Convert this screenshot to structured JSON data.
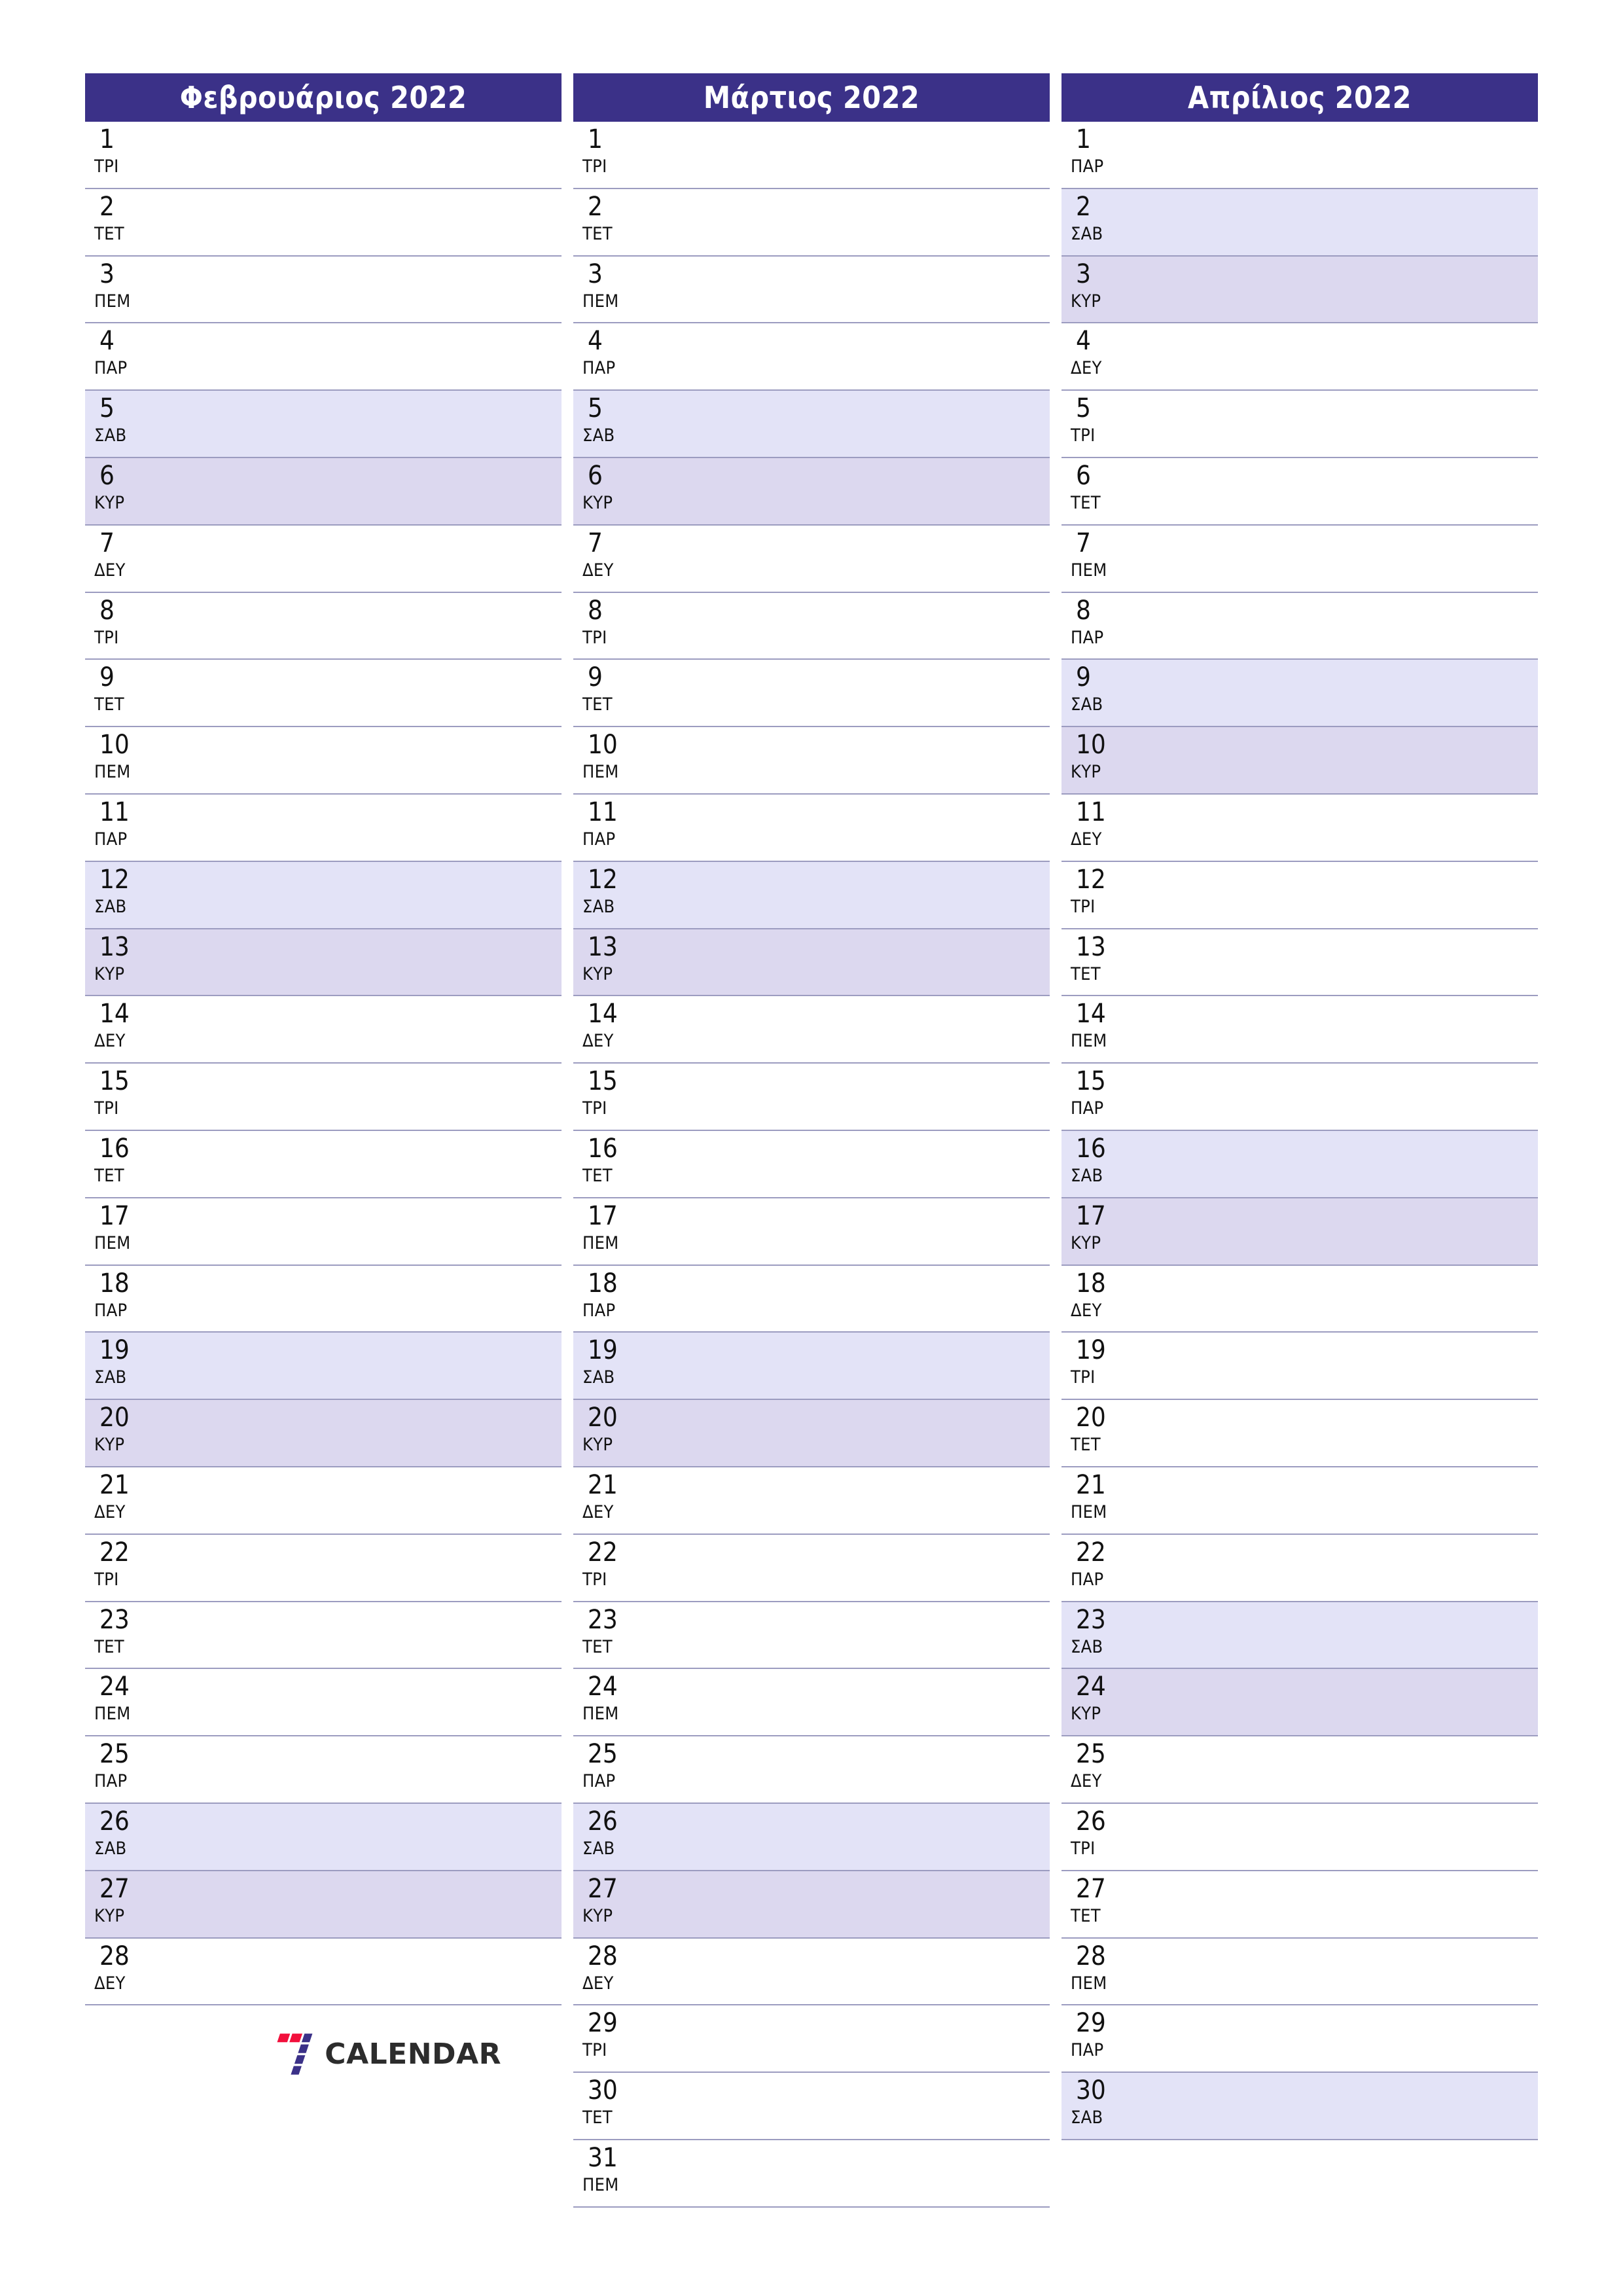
{
  "colors": {
    "header_bg": "#3b3188",
    "header_text": "#ffffff",
    "saturday_bg": "#e3e3f7",
    "sunday_bg": "#dcd8ef",
    "row_divider": "#9c9cc0",
    "day_text": "#111111",
    "logo_red": "#f2103c",
    "logo_blue": "#3b3188",
    "logo_word": "#2c2c2c"
  },
  "logo": {
    "mark": "seven-logo-icon",
    "word": "CALENDAR"
  },
  "months": [
    {
      "title": "Φεβρουάριος 2022",
      "days": [
        {
          "num": "1",
          "abbr": "ΤΡΙ",
          "type": "weekday"
        },
        {
          "num": "2",
          "abbr": "ΤΕΤ",
          "type": "weekday"
        },
        {
          "num": "3",
          "abbr": "ΠΕΜ",
          "type": "weekday"
        },
        {
          "num": "4",
          "abbr": "ΠΑΡ",
          "type": "weekday"
        },
        {
          "num": "5",
          "abbr": "ΣΑΒ",
          "type": "sat"
        },
        {
          "num": "6",
          "abbr": "ΚΥΡ",
          "type": "sun"
        },
        {
          "num": "7",
          "abbr": "ΔΕΥ",
          "type": "weekday"
        },
        {
          "num": "8",
          "abbr": "ΤΡΙ",
          "type": "weekday"
        },
        {
          "num": "9",
          "abbr": "ΤΕΤ",
          "type": "weekday"
        },
        {
          "num": "10",
          "abbr": "ΠΕΜ",
          "type": "weekday"
        },
        {
          "num": "11",
          "abbr": "ΠΑΡ",
          "type": "weekday"
        },
        {
          "num": "12",
          "abbr": "ΣΑΒ",
          "type": "sat"
        },
        {
          "num": "13",
          "abbr": "ΚΥΡ",
          "type": "sun"
        },
        {
          "num": "14",
          "abbr": "ΔΕΥ",
          "type": "weekday"
        },
        {
          "num": "15",
          "abbr": "ΤΡΙ",
          "type": "weekday"
        },
        {
          "num": "16",
          "abbr": "ΤΕΤ",
          "type": "weekday"
        },
        {
          "num": "17",
          "abbr": "ΠΕΜ",
          "type": "weekday"
        },
        {
          "num": "18",
          "abbr": "ΠΑΡ",
          "type": "weekday"
        },
        {
          "num": "19",
          "abbr": "ΣΑΒ",
          "type": "sat"
        },
        {
          "num": "20",
          "abbr": "ΚΥΡ",
          "type": "sun"
        },
        {
          "num": "21",
          "abbr": "ΔΕΥ",
          "type": "weekday"
        },
        {
          "num": "22",
          "abbr": "ΤΡΙ",
          "type": "weekday"
        },
        {
          "num": "23",
          "abbr": "ΤΕΤ",
          "type": "weekday"
        },
        {
          "num": "24",
          "abbr": "ΠΕΜ",
          "type": "weekday"
        },
        {
          "num": "25",
          "abbr": "ΠΑΡ",
          "type": "weekday"
        },
        {
          "num": "26",
          "abbr": "ΣΑΒ",
          "type": "sat"
        },
        {
          "num": "27",
          "abbr": "ΚΥΡ",
          "type": "sun"
        },
        {
          "num": "28",
          "abbr": "ΔΕΥ",
          "type": "weekday"
        }
      ],
      "has_logo": true
    },
    {
      "title": "Μάρτιος 2022",
      "days": [
        {
          "num": "1",
          "abbr": "ΤΡΙ",
          "type": "weekday"
        },
        {
          "num": "2",
          "abbr": "ΤΕΤ",
          "type": "weekday"
        },
        {
          "num": "3",
          "abbr": "ΠΕΜ",
          "type": "weekday"
        },
        {
          "num": "4",
          "abbr": "ΠΑΡ",
          "type": "weekday"
        },
        {
          "num": "5",
          "abbr": "ΣΑΒ",
          "type": "sat"
        },
        {
          "num": "6",
          "abbr": "ΚΥΡ",
          "type": "sun"
        },
        {
          "num": "7",
          "abbr": "ΔΕΥ",
          "type": "weekday"
        },
        {
          "num": "8",
          "abbr": "ΤΡΙ",
          "type": "weekday"
        },
        {
          "num": "9",
          "abbr": "ΤΕΤ",
          "type": "weekday"
        },
        {
          "num": "10",
          "abbr": "ΠΕΜ",
          "type": "weekday"
        },
        {
          "num": "11",
          "abbr": "ΠΑΡ",
          "type": "weekday"
        },
        {
          "num": "12",
          "abbr": "ΣΑΒ",
          "type": "sat"
        },
        {
          "num": "13",
          "abbr": "ΚΥΡ",
          "type": "sun"
        },
        {
          "num": "14",
          "abbr": "ΔΕΥ",
          "type": "weekday"
        },
        {
          "num": "15",
          "abbr": "ΤΡΙ",
          "type": "weekday"
        },
        {
          "num": "16",
          "abbr": "ΤΕΤ",
          "type": "weekday"
        },
        {
          "num": "17",
          "abbr": "ΠΕΜ",
          "type": "weekday"
        },
        {
          "num": "18",
          "abbr": "ΠΑΡ",
          "type": "weekday"
        },
        {
          "num": "19",
          "abbr": "ΣΑΒ",
          "type": "sat"
        },
        {
          "num": "20",
          "abbr": "ΚΥΡ",
          "type": "sun"
        },
        {
          "num": "21",
          "abbr": "ΔΕΥ",
          "type": "weekday"
        },
        {
          "num": "22",
          "abbr": "ΤΡΙ",
          "type": "weekday"
        },
        {
          "num": "23",
          "abbr": "ΤΕΤ",
          "type": "weekday"
        },
        {
          "num": "24",
          "abbr": "ΠΕΜ",
          "type": "weekday"
        },
        {
          "num": "25",
          "abbr": "ΠΑΡ",
          "type": "weekday"
        },
        {
          "num": "26",
          "abbr": "ΣΑΒ",
          "type": "sat"
        },
        {
          "num": "27",
          "abbr": "ΚΥΡ",
          "type": "sun"
        },
        {
          "num": "28",
          "abbr": "ΔΕΥ",
          "type": "weekday"
        },
        {
          "num": "29",
          "abbr": "ΤΡΙ",
          "type": "weekday"
        },
        {
          "num": "30",
          "abbr": "ΤΕΤ",
          "type": "weekday"
        },
        {
          "num": "31",
          "abbr": "ΠΕΜ",
          "type": "weekday"
        }
      ],
      "has_logo": false
    },
    {
      "title": "Απρίλιος 2022",
      "days": [
        {
          "num": "1",
          "abbr": "ΠΑΡ",
          "type": "weekday"
        },
        {
          "num": "2",
          "abbr": "ΣΑΒ",
          "type": "sat"
        },
        {
          "num": "3",
          "abbr": "ΚΥΡ",
          "type": "sun"
        },
        {
          "num": "4",
          "abbr": "ΔΕΥ",
          "type": "weekday"
        },
        {
          "num": "5",
          "abbr": "ΤΡΙ",
          "type": "weekday"
        },
        {
          "num": "6",
          "abbr": "ΤΕΤ",
          "type": "weekday"
        },
        {
          "num": "7",
          "abbr": "ΠΕΜ",
          "type": "weekday"
        },
        {
          "num": "8",
          "abbr": "ΠΑΡ",
          "type": "weekday"
        },
        {
          "num": "9",
          "abbr": "ΣΑΒ",
          "type": "sat"
        },
        {
          "num": "10",
          "abbr": "ΚΥΡ",
          "type": "sun"
        },
        {
          "num": "11",
          "abbr": "ΔΕΥ",
          "type": "weekday"
        },
        {
          "num": "12",
          "abbr": "ΤΡΙ",
          "type": "weekday"
        },
        {
          "num": "13",
          "abbr": "ΤΕΤ",
          "type": "weekday"
        },
        {
          "num": "14",
          "abbr": "ΠΕΜ",
          "type": "weekday"
        },
        {
          "num": "15",
          "abbr": "ΠΑΡ",
          "type": "weekday"
        },
        {
          "num": "16",
          "abbr": "ΣΑΒ",
          "type": "sat"
        },
        {
          "num": "17",
          "abbr": "ΚΥΡ",
          "type": "sun"
        },
        {
          "num": "18",
          "abbr": "ΔΕΥ",
          "type": "weekday"
        },
        {
          "num": "19",
          "abbr": "ΤΡΙ",
          "type": "weekday"
        },
        {
          "num": "20",
          "abbr": "ΤΕΤ",
          "type": "weekday"
        },
        {
          "num": "21",
          "abbr": "ΠΕΜ",
          "type": "weekday"
        },
        {
          "num": "22",
          "abbr": "ΠΑΡ",
          "type": "weekday"
        },
        {
          "num": "23",
          "abbr": "ΣΑΒ",
          "type": "sat"
        },
        {
          "num": "24",
          "abbr": "ΚΥΡ",
          "type": "sun"
        },
        {
          "num": "25",
          "abbr": "ΔΕΥ",
          "type": "weekday"
        },
        {
          "num": "26",
          "abbr": "ΤΡΙ",
          "type": "weekday"
        },
        {
          "num": "27",
          "abbr": "ΤΕΤ",
          "type": "weekday"
        },
        {
          "num": "28",
          "abbr": "ΠΕΜ",
          "type": "weekday"
        },
        {
          "num": "29",
          "abbr": "ΠΑΡ",
          "type": "weekday"
        },
        {
          "num": "30",
          "abbr": "ΣΑΒ",
          "type": "sat"
        }
      ],
      "has_logo": false
    }
  ]
}
